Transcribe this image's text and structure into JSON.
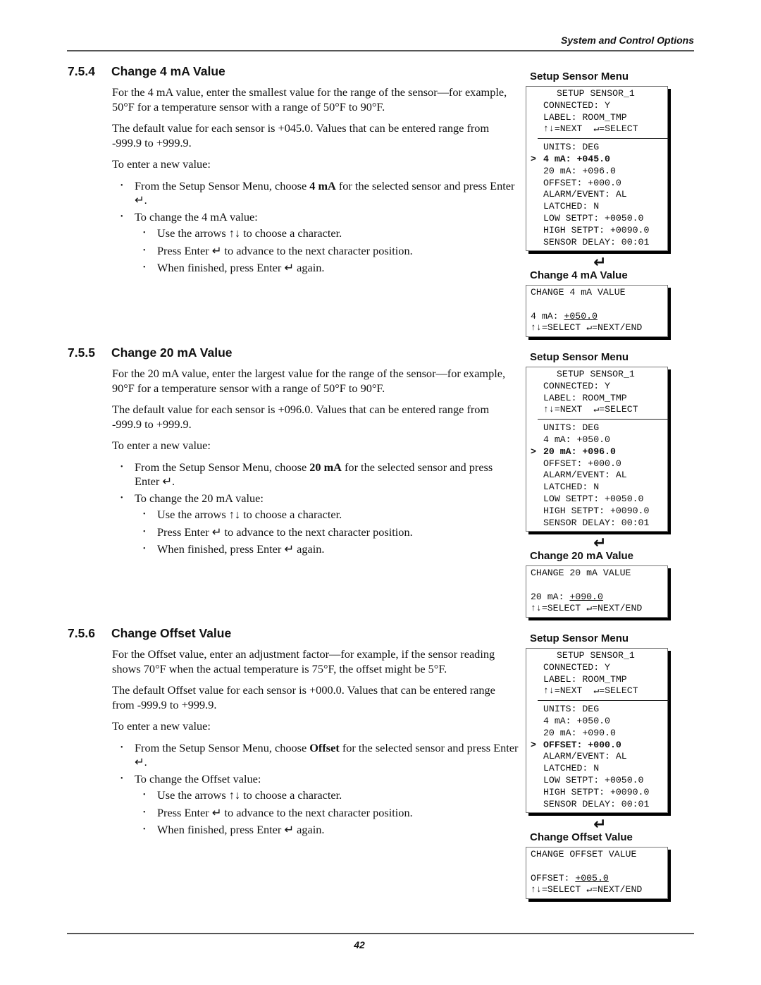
{
  "header": {
    "title": "System and Control Options"
  },
  "footer": {
    "page_number": "42"
  },
  "sections": [
    {
      "number": "7.5.4",
      "title": "Change 4 mA Value",
      "para1": "For the 4 mA value, enter the smallest value for the range of the sen­sor—for example, 50°F for a temperature sensor with a range of 50°F to 90°F.",
      "para2": "The default value for each sensor is +045.0. Values that can be entered range from -999.9 to +999.9.",
      "intro": "To enter a new value:",
      "bullet1_pre": "From the Setup Sensor Menu, choose ",
      "bullet1_bold": "4 mA",
      "bullet1_post": " for the selected sensor and press Enter ↵.",
      "bullet2": "To change the 4 mA value:",
      "sub1": "Use the arrows ↑↓ to choose a character.",
      "sub2": "Press Enter ↵ to advance to the next character position.",
      "sub3": "When finished, press Enter ↵ again."
    },
    {
      "number": "7.5.5",
      "title": "Change 20 mA Value",
      "para1": "For the 20 mA value, enter the largest value for the range of the sen­sor—for example, 90°F for a temperature sensor with a range of 50°F to 90°F.",
      "para2": "The default value for each sensor is +096.0. Values that can be entered range from -999.9 to +999.9.",
      "intro": "To enter a new value:",
      "bullet1_pre": "From the Setup Sensor Menu, choose ",
      "bullet1_bold": "20 mA",
      "bullet1_post": " for the selected sen­sor and press Enter ↵.",
      "bullet2": "To change the 20 mA value:",
      "sub1": "Use the arrows ↑↓ to choose a character.",
      "sub2": "Press Enter ↵ to advance to the next character position.",
      "sub3": "When finished, press Enter ↵ again."
    },
    {
      "number": "7.5.6",
      "title": "Change Offset Value",
      "para1": "For the Offset value, enter an adjustment factor—for example, if the sensor reading shows 70°F when the actual temperature is 75°F, the offset might be 5°F.",
      "para2": "The default Offset value for each sensor is +000.0. Values that can be entered range from -999.9 to +999.9.",
      "intro": "To enter a new value:",
      "bullet1_pre": "From the Setup Sensor Menu, choose ",
      "bullet1_bold": "Offset",
      "bullet1_post": " for the selected sensor and press Enter ↵.",
      "bullet2": "To change the Offset value:",
      "sub1": "Use the arrows ↑↓ to choose a character.",
      "sub2": "Press Enter ↵ to advance to the next character position.",
      "sub3": "When finished, press Enter ↵ again."
    }
  ],
  "panels": [
    {
      "menu_label": "Setup Sensor Menu",
      "menu_title": "SETUP SENSOR_1",
      "connected": "CONNECTED: Y",
      "label": "LABEL: ROOM_TMP",
      "nav": "↑↓=NEXT  ↵=SELECT",
      "cursor": ">",
      "rows": [
        "UNITS: DEG",
        "4 mA: +045.0",
        "20 mA: +096.0",
        "OFFSET: +000.0",
        "ALARM/EVENT: AL",
        "LATCHED: N",
        "LOW SETPT: +0050.0",
        "HIGH SETPT: +0090.0",
        "SENSOR DELAY: 00:01"
      ],
      "selected_index": 1,
      "enter_icon": "↵",
      "change_label": "Change 4 mA Value",
      "change_title": "CHANGE 4 mA VALUE",
      "change_field": "4 mA: ",
      "change_value": "+050.0",
      "change_help": "↑↓=SELECT ↵=NEXT/END"
    },
    {
      "menu_label": "Setup Sensor Menu",
      "menu_title": "SETUP SENSOR_1",
      "connected": "CONNECTED: Y",
      "label": "LABEL: ROOM_TMP",
      "nav": "↑↓=NEXT  ↵=SELECT",
      "cursor": ">",
      "rows": [
        "UNITS: DEG",
        "4 mA: +050.0",
        "20 mA: +096.0",
        "OFFSET: +000.0",
        "ALARM/EVENT: AL",
        "LATCHED: N",
        "LOW SETPT: +0050.0",
        "HIGH SETPT: +0090.0",
        "SENSOR DELAY: 00:01"
      ],
      "selected_index": 2,
      "enter_icon": "↵",
      "change_label": "Change 20 mA Value",
      "change_title": "CHANGE 20 mA VALUE",
      "change_field": "20 mA: ",
      "change_value": "+090.0",
      "change_help": "↑↓=SELECT ↵=NEXT/END"
    },
    {
      "menu_label": "Setup Sensor Menu",
      "menu_title": "SETUP SENSOR_1",
      "connected": "CONNECTED: Y",
      "label": "LABEL: ROOM_TMP",
      "nav": "↑↓=NEXT  ↵=SELECT",
      "cursor": ">",
      "rows": [
        "UNITS: DEG",
        "4 mA: +050.0",
        "20 mA: +090.0",
        "OFFSET: +000.0",
        "ALARM/EVENT: AL",
        "LATCHED: N",
        "LOW SETPT: +0050.0",
        "HIGH SETPT: +0090.0",
        "SENSOR DELAY: 00:01"
      ],
      "selected_index": 3,
      "enter_icon": "↵",
      "change_label": "Change Offset Value",
      "change_title": "CHANGE OFFSET VALUE",
      "change_field": "OFFSET: ",
      "change_value": "+005.0",
      "change_help": "↑↓=SELECT ↵=NEXT/END"
    }
  ]
}
